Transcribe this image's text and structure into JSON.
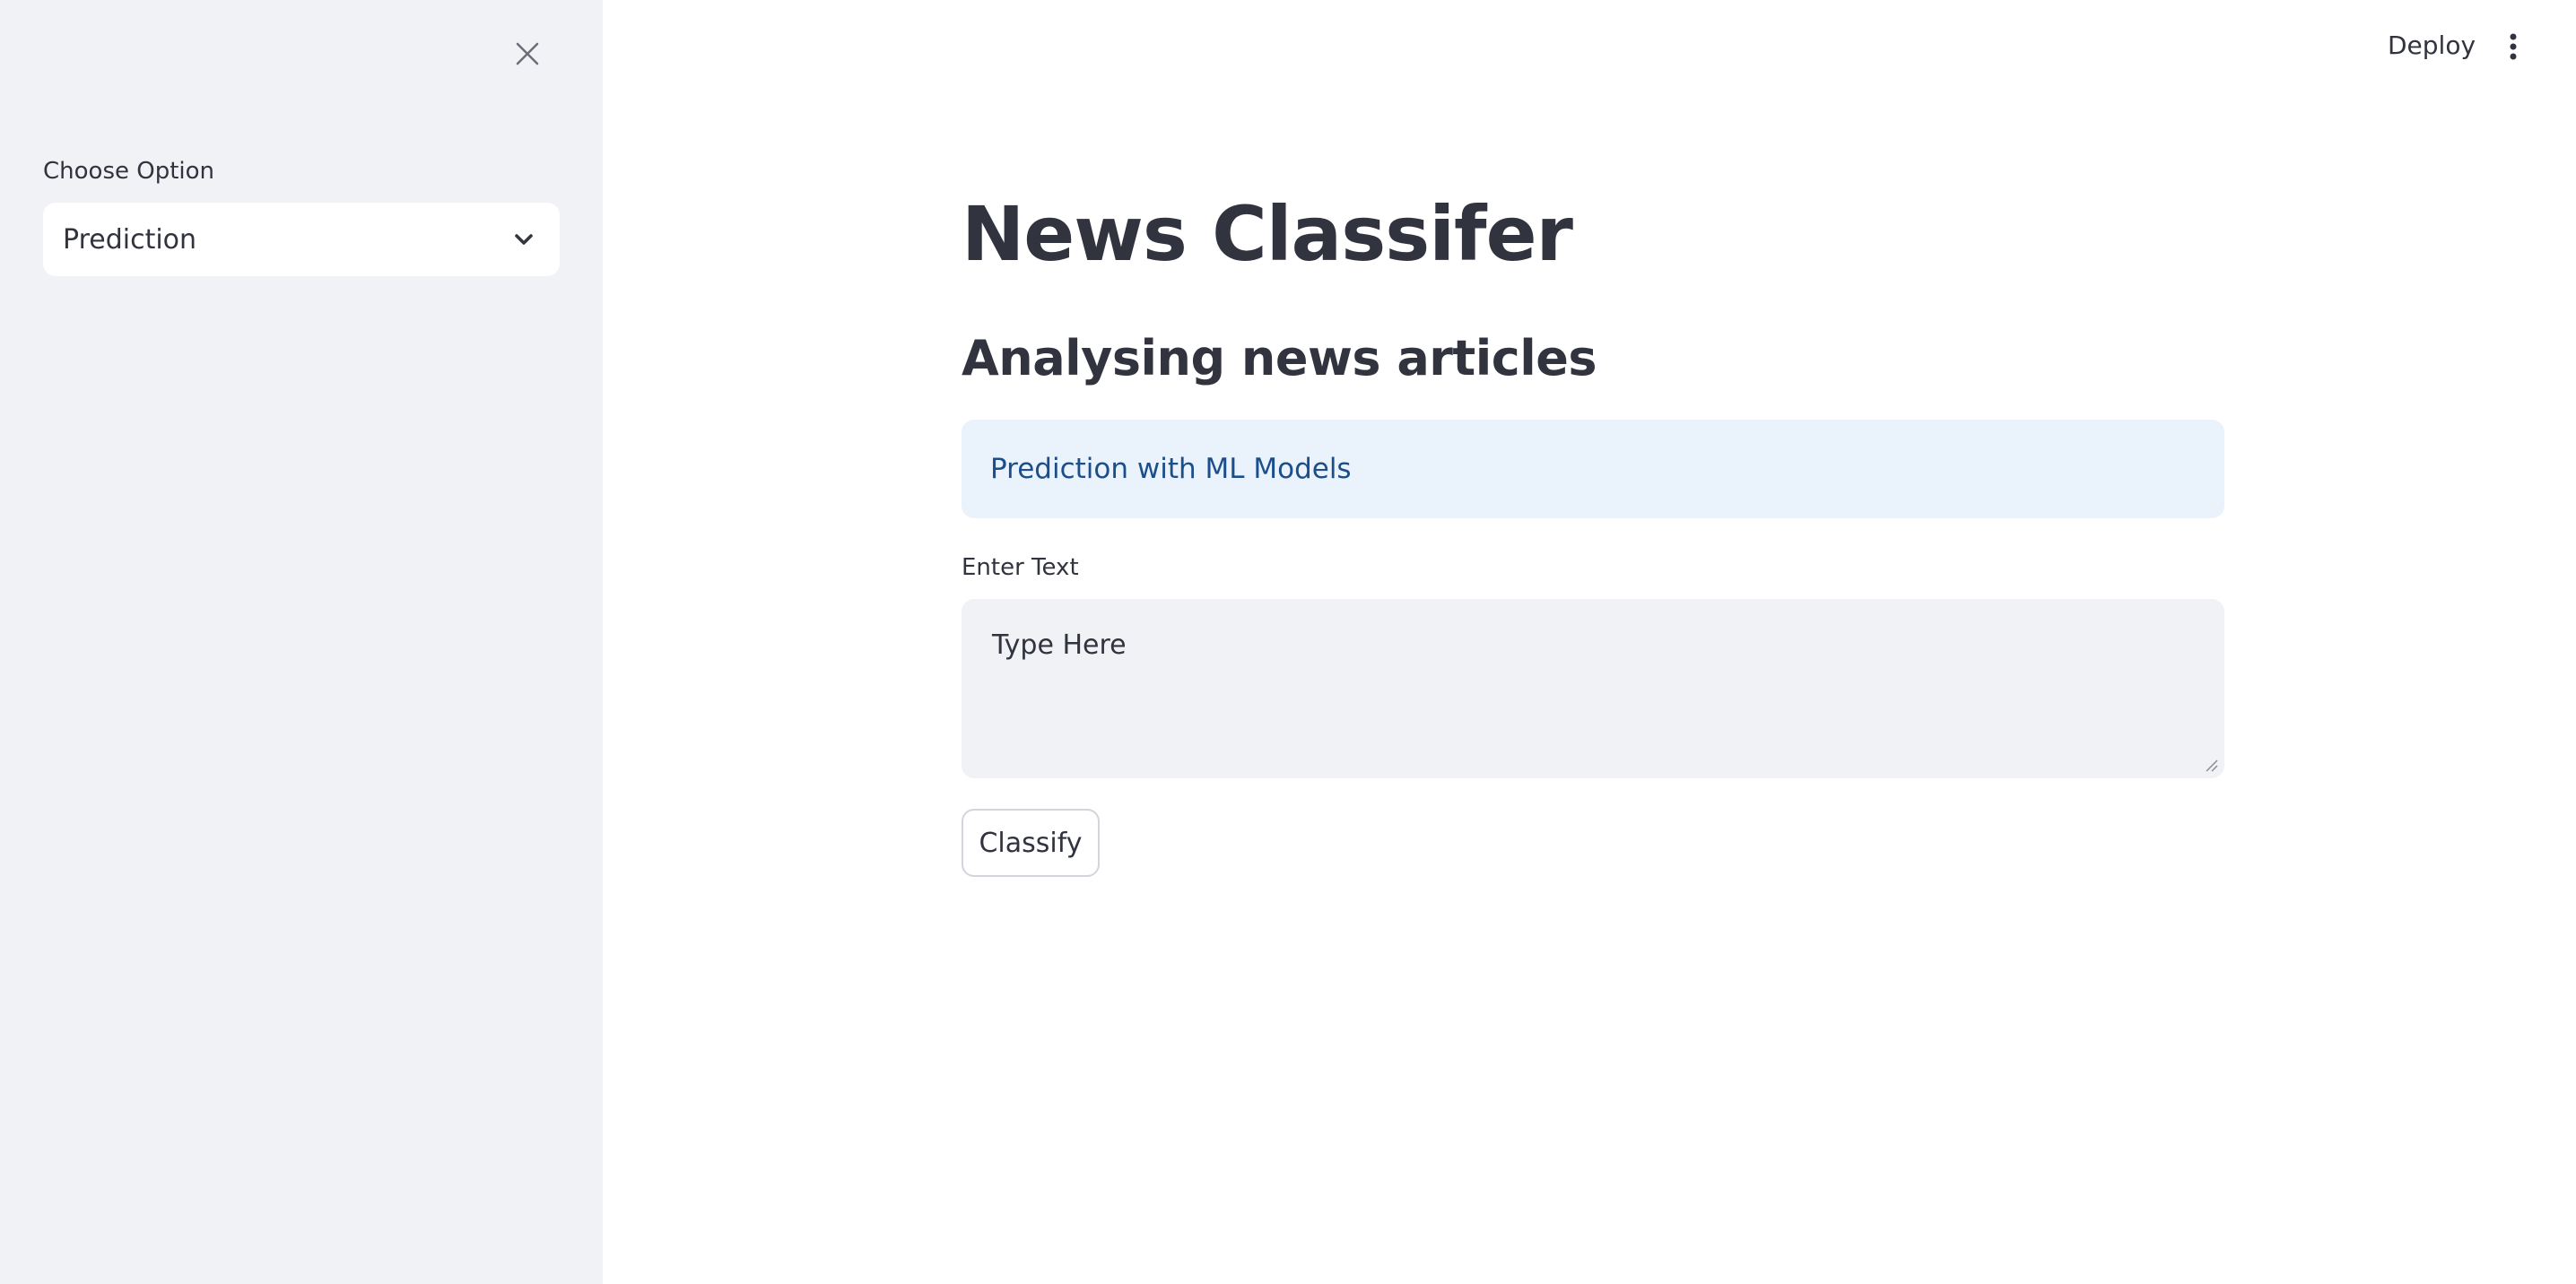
{
  "sidebar": {
    "close_icon": "close-icon",
    "select_label": "Choose Option",
    "select_value": "Prediction",
    "chevron_icon": "chevron-down-icon"
  },
  "header": {
    "deploy_label": "Deploy",
    "menu_icon": "more-vertical-icon"
  },
  "main": {
    "title": "News Classifer",
    "subtitle": "Analysing news articles",
    "info_text": "Prediction with ML Models",
    "input_label": "Enter Text",
    "input_value": "Type Here",
    "button_label": "Classify"
  },
  "colors": {
    "sidebar_bg": "#f0f2f6",
    "info_bg": "#eaf2fc",
    "info_text": "#1b4e8a",
    "text": "#31333f"
  }
}
